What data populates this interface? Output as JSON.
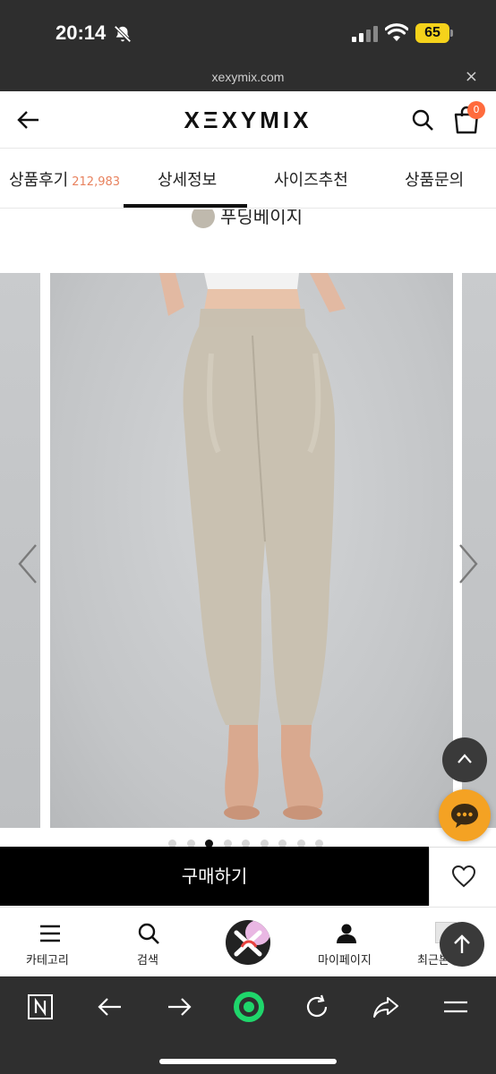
{
  "status_bar": {
    "time": "20:14",
    "battery": "65",
    "icons": [
      "bell-slash-icon",
      "signal-icon",
      "wifi-icon",
      "battery-icon"
    ]
  },
  "url_bar": {
    "url": "xexymix.com",
    "close": "×"
  },
  "header": {
    "logo": "XΞXYMIX",
    "cart_count": "0",
    "icons": [
      "back-arrow-icon",
      "search-icon",
      "cart-icon"
    ]
  },
  "tabs": {
    "review_label": "상품후기",
    "review_count": "212,983",
    "detail_label": "상세정보",
    "size_label": "사이즈추천",
    "qna_label": "상품문의",
    "active": "상세정보"
  },
  "product": {
    "color_name": "푸딩베이지",
    "color_hex": "#bfb9ad"
  },
  "carousel": {
    "dot_count": 9,
    "active_index": 2
  },
  "buy_bar": {
    "buy_label": "구매하기"
  },
  "bottom_nav": {
    "items": [
      {
        "label": "카테고리",
        "icon": "menu-icon"
      },
      {
        "label": "검색",
        "icon": "search-icon"
      },
      {
        "label": "",
        "icon": "brand-logo-icon"
      },
      {
        "label": "마이페이지",
        "icon": "user-icon"
      },
      {
        "label": "최근본",
        "icon": "recent-icon"
      }
    ]
  },
  "browser_toolbar": {
    "icons": [
      "naver-icon",
      "back-icon",
      "forward-icon",
      "home-icon",
      "reload-icon",
      "share-icon",
      "menu-icon"
    ]
  },
  "colors": {
    "accent": "#ff6b3d",
    "chat": "#f4a223",
    "review_count": "#e8825e"
  }
}
